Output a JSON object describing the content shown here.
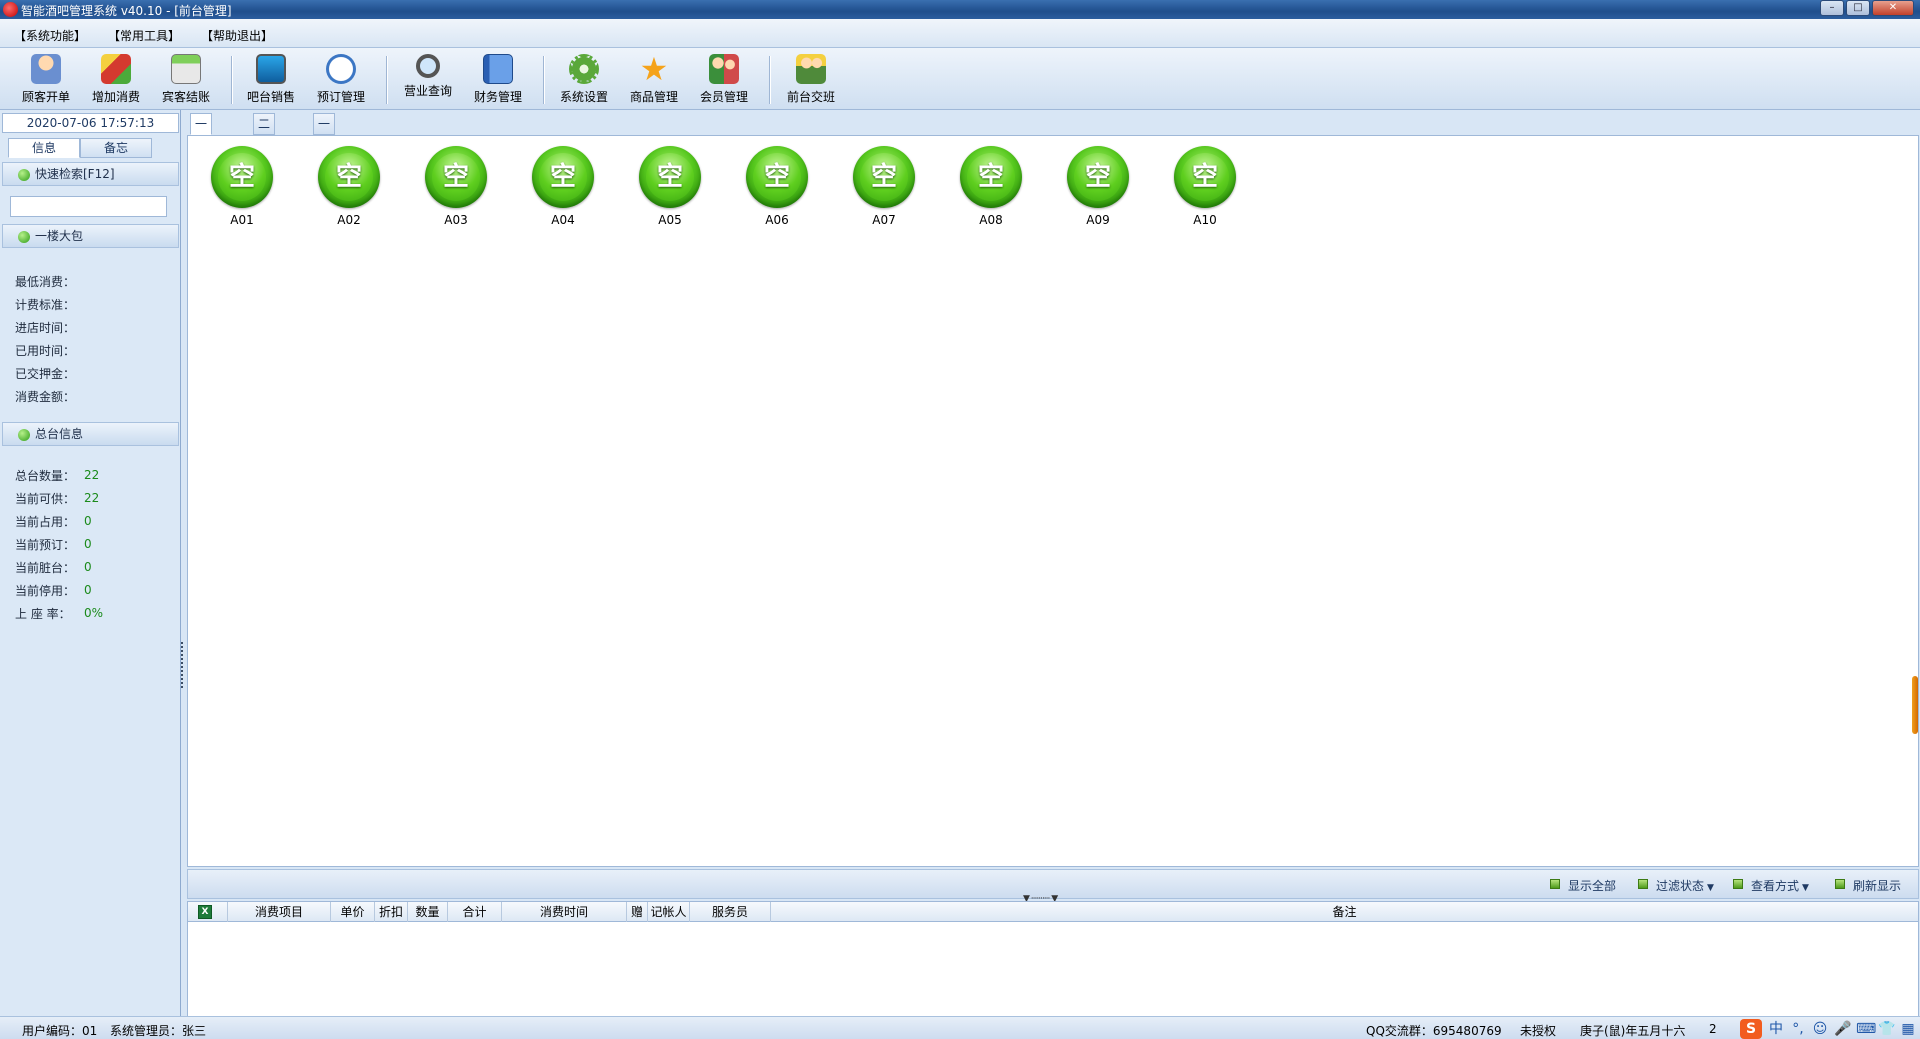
{
  "window": {
    "title": "智能酒吧管理系统 v40.10 - [前台管理]",
    "minimize": "–",
    "maximize": "□",
    "close": "✕"
  },
  "menu": [
    "【系统功能】",
    "【常用工具】",
    "【帮助退出】"
  ],
  "toolbar": [
    {
      "label": "顾客开单",
      "icon": "customer-open-icon",
      "color": "#6a8fd0"
    },
    {
      "label": "增加消费",
      "icon": "add-consumption-icon",
      "color": "#d43a2f"
    },
    {
      "label": "宾客结账",
      "icon": "checkout-calculator-icon",
      "color": "#4caa3a"
    },
    {
      "label": "吧台销售",
      "icon": "bar-sales-monitor-icon",
      "color": "#1e88c8"
    },
    {
      "label": "预订管理",
      "icon": "reservation-clock-icon",
      "color": "#3b76c4"
    },
    {
      "label": "营业查询",
      "icon": "search-magnifier-icon",
      "color": "#8a9bb0"
    },
    {
      "label": "财务管理",
      "icon": "finance-notebook-icon",
      "color": "#3a6fc4"
    },
    {
      "label": "系统设置",
      "icon": "gear-icon",
      "color": "#5aa83a"
    },
    {
      "label": "商品管理",
      "icon": "star-icon",
      "color": "#f5a31b"
    },
    {
      "label": "会员管理",
      "icon": "members-icon",
      "color": "#d04a4a"
    },
    {
      "label": "前台交班",
      "icon": "shift-handover-icon",
      "color": "#4f8a3a"
    }
  ],
  "left": {
    "datetime": "2020-07-06 17:57:13",
    "tabs": [
      "信息",
      "备忘"
    ],
    "quick_search": "快速检索[F12]",
    "search_value": "",
    "room_section": "一楼大包",
    "room_info": [
      "最低消费：",
      "计费标准：",
      "进店时间：",
      "已用时间：",
      "已交押金：",
      "消费金额："
    ],
    "summary_section": "总台信息",
    "summary": [
      {
        "label": "总台数量：",
        "value": "22"
      },
      {
        "label": "当前可供：",
        "value": "22"
      },
      {
        "label": "当前占用：",
        "value": "0"
      },
      {
        "label": "当前预订：",
        "value": "0"
      },
      {
        "label": "当前脏台：",
        "value": "0"
      },
      {
        "label": "当前停用：",
        "value": "0"
      },
      {
        "label": "上 座 率：",
        "value": "0%"
      }
    ]
  },
  "area_tabs": [
    "一楼大包",
    "二楼小包",
    "一楼大厅"
  ],
  "rooms": [
    {
      "name": "A01",
      "status": "空"
    },
    {
      "name": "A02",
      "status": "空"
    },
    {
      "name": "A03",
      "status": "空"
    },
    {
      "name": "A04",
      "status": "空"
    },
    {
      "name": "A05",
      "status": "空"
    },
    {
      "name": "A06",
      "status": "空"
    },
    {
      "name": "A07",
      "status": "空"
    },
    {
      "name": "A08",
      "status": "空"
    },
    {
      "name": "A09",
      "status": "空"
    },
    {
      "name": "A10",
      "status": "空"
    }
  ],
  "filter_bar": {
    "show_all": "显示全部",
    "filter_status": "过滤状态",
    "view_mode": "查看方式",
    "refresh": "刷新显示"
  },
  "grid": {
    "excel": "X",
    "columns": [
      "消费项目",
      "单价",
      "折扣",
      "数量",
      "合计",
      "消费时间",
      "赠",
      "记帐人",
      "服务员",
      "备注"
    ]
  },
  "status": {
    "user_code": "用户编码：01",
    "admin": "系统管理员：张三",
    "qq": "QQ交流群：695480769",
    "license": "未授权",
    "lunar": "庚子(鼠)年五月十六",
    "extra": "2"
  },
  "tray": {
    "ime_logo": "S",
    "ime_lang": "中",
    "punct": "°,",
    "emoji": "☺",
    "mic": "🎤",
    "keyboard": "⌨",
    "skin": "👕",
    "grid": "▦"
  }
}
